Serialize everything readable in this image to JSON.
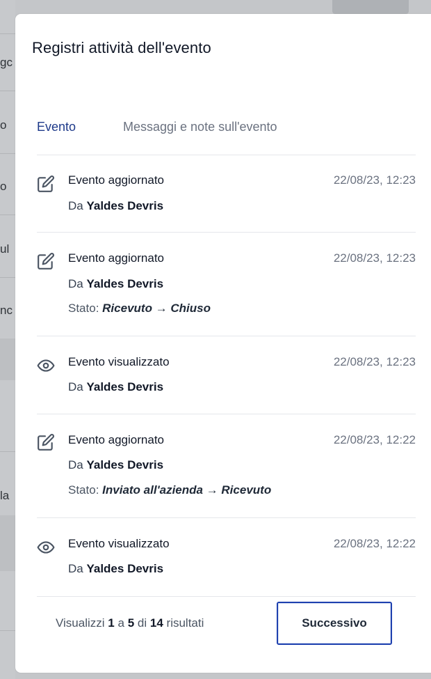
{
  "modal": {
    "title": "Registri attività dell'evento"
  },
  "tabs": [
    {
      "label": "Evento",
      "active": true
    },
    {
      "label": "Messaggi e note sull'evento",
      "active": false
    }
  ],
  "logs": [
    {
      "icon": "edit-icon",
      "title": "Evento aggiornato",
      "time": "22/08/23, 12:23",
      "by_prefix": "Da",
      "by_name": "Yaldes Devris",
      "status_label": "",
      "status_value": ""
    },
    {
      "icon": "edit-icon",
      "title": "Evento aggiornato",
      "time": "22/08/23, 12:23",
      "by_prefix": "Da",
      "by_name": "Yaldes Devris",
      "status_label": "Stato:",
      "status_value": "Ricevuto → Chiuso"
    },
    {
      "icon": "eye-icon",
      "title": "Evento visualizzato",
      "time": "22/08/23, 12:23",
      "by_prefix": "Da",
      "by_name": "Yaldes Devris",
      "status_label": "",
      "status_value": ""
    },
    {
      "icon": "edit-icon",
      "title": "Evento aggiornato",
      "time": "22/08/23, 12:22",
      "by_prefix": "Da",
      "by_name": "Yaldes Devris",
      "status_label": "Stato:",
      "status_value": "Inviato all'azienda → Ricevuto"
    },
    {
      "icon": "eye-icon",
      "title": "Evento visualizzato",
      "time": "22/08/23, 12:22",
      "by_prefix": "Da",
      "by_name": "Yaldes Devris",
      "status_label": "",
      "status_value": ""
    }
  ],
  "pagination": {
    "prefix": "Visualizzi",
    "from": "1",
    "sep1": "a",
    "to": "5",
    "sep2": "di",
    "total": "14",
    "suffix": "risultati",
    "next_label": "Successivo"
  },
  "background": {
    "fragments": [
      "gc",
      "o",
      "o",
      "ul",
      "nc",
      "la"
    ]
  },
  "colors": {
    "active_tab": "#1e3a8a",
    "button_border": "#1e40af",
    "overlay": "#c4c6c9"
  }
}
